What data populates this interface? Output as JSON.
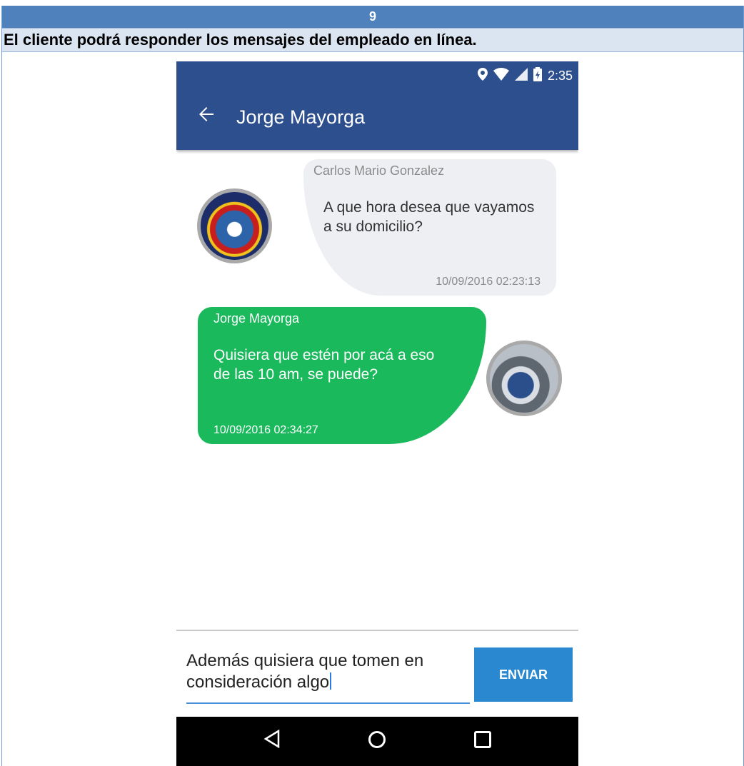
{
  "document": {
    "header_number": "9",
    "description": "El cliente podrá responder los mensajes del empleado en línea."
  },
  "status_bar": {
    "time": "2:35",
    "icons": [
      "location-icon",
      "wifi-icon",
      "signal-icon",
      "battery-charging-icon"
    ]
  },
  "app_bar": {
    "back_icon": "arrow-left-icon",
    "title": "Jorge Mayorga"
  },
  "messages": [
    {
      "direction": "incoming",
      "sender": "Carlos Mario Gonzalez",
      "text": "A que hora desea que vayamos a su domicilio?",
      "timestamp": "10/09/2016 02:23:13",
      "bubble_color": "#eeeff3"
    },
    {
      "direction": "outgoing",
      "sender": "Jorge Mayorga",
      "text": "Quisiera que estén por acá a eso de las 10 am, se puede?",
      "timestamp": "10/09/2016 02:34:27",
      "bubble_color": "#1ab95c"
    }
  ],
  "compose": {
    "value": "Además quisiera que tomen en consideración algo",
    "send_label": "ENVIAR"
  },
  "nav_bar": {
    "buttons": [
      "back-triangle-icon",
      "home-circle-icon",
      "recents-square-icon"
    ]
  },
  "colors": {
    "header_blue": "#4f81bd",
    "subheader_bg": "#dbe5f1",
    "app_bar": "#2e4f8e",
    "send_button": "#2a88d1",
    "outgoing_bubble": "#1ab95c"
  }
}
